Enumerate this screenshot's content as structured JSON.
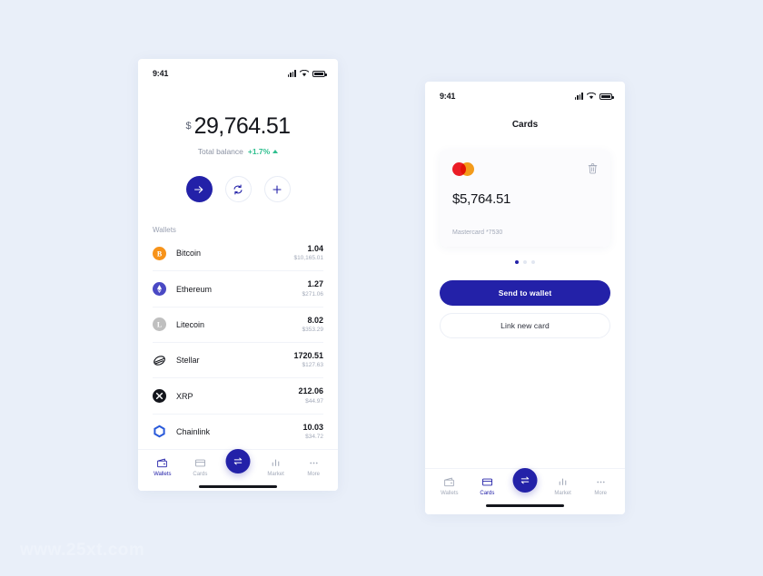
{
  "canvas": {
    "background": "#e9eff9",
    "watermark": "www.25xt.com"
  },
  "theme": {
    "primary": "#2321a8",
    "positive": "#2fbf8f",
    "text": "#14161c",
    "muted": "#a3aab9"
  },
  "phone_wallets": {
    "status": {
      "time": "9:41",
      "signal_icon": "signal-bars-icon",
      "wifi_icon": "wifi-icon",
      "battery_icon": "battery-icon"
    },
    "balance": {
      "currency_symbol": "$",
      "amount": "29,764.51",
      "label": "Total balance",
      "delta": "+1.7%",
      "delta_direction": "up"
    },
    "actions": [
      {
        "name": "send-button",
        "icon": "arrow-right-icon"
      },
      {
        "name": "exchange-button",
        "icon": "refresh-icon"
      },
      {
        "name": "add-button",
        "icon": "plus-icon"
      }
    ],
    "wallets_label": "Wallets",
    "wallets": [
      {
        "name": "Bitcoin",
        "amount": "1.04",
        "fiat": "$10,165.01",
        "icon": "bitcoin-icon",
        "color": "#f7931a"
      },
      {
        "name": "Ethereum",
        "amount": "1.27",
        "fiat": "$271.06",
        "icon": "ethereum-icon",
        "color": "#4a49c4"
      },
      {
        "name": "Litecoin",
        "amount": "8.02",
        "fiat": "$353.29",
        "icon": "litecoin-icon",
        "color": "#bfbfbf"
      },
      {
        "name": "Stellar",
        "amount": "1720.51",
        "fiat": "$127.63",
        "icon": "stellar-icon",
        "color": "#14161c"
      },
      {
        "name": "XRP",
        "amount": "212.06",
        "fiat": "$44.97",
        "icon": "xrp-icon",
        "color": "#14161c"
      },
      {
        "name": "Chainlink",
        "amount": "10.03",
        "fiat": "$34.72",
        "icon": "chainlink-icon",
        "color": "#2a5ada"
      }
    ],
    "tabs": [
      {
        "label": "Wallets",
        "icon": "wallet-icon",
        "active": true
      },
      {
        "label": "Cards",
        "icon": "card-icon",
        "active": false
      },
      {
        "label": "Market",
        "icon": "chart-bars-icon",
        "active": false
      },
      {
        "label": "More",
        "icon": "ellipsis-icon",
        "active": false
      }
    ],
    "fab": {
      "name": "exchange-fab",
      "icon": "swap-arrows-icon"
    }
  },
  "phone_cards": {
    "status": {
      "time": "9:41",
      "signal_icon": "signal-bars-icon",
      "wifi_icon": "wifi-icon",
      "battery_icon": "battery-icon"
    },
    "title": "Cards",
    "card": {
      "brand_icon": "mastercard-icon",
      "delete_icon": "trash-icon",
      "amount": "$5,764.51",
      "footer": "Mastercard *7530"
    },
    "pagination": {
      "total": 3,
      "active_index": 0
    },
    "buttons": {
      "primary": "Send to wallet",
      "secondary": "Link new card"
    },
    "tabs": [
      {
        "label": "Wallets",
        "icon": "wallet-icon",
        "active": false
      },
      {
        "label": "Cards",
        "icon": "card-icon",
        "active": true
      },
      {
        "label": "Market",
        "icon": "chart-bars-icon",
        "active": false
      },
      {
        "label": "More",
        "icon": "ellipsis-icon",
        "active": false
      }
    ],
    "fab": {
      "name": "exchange-fab",
      "icon": "swap-arrows-icon"
    }
  }
}
